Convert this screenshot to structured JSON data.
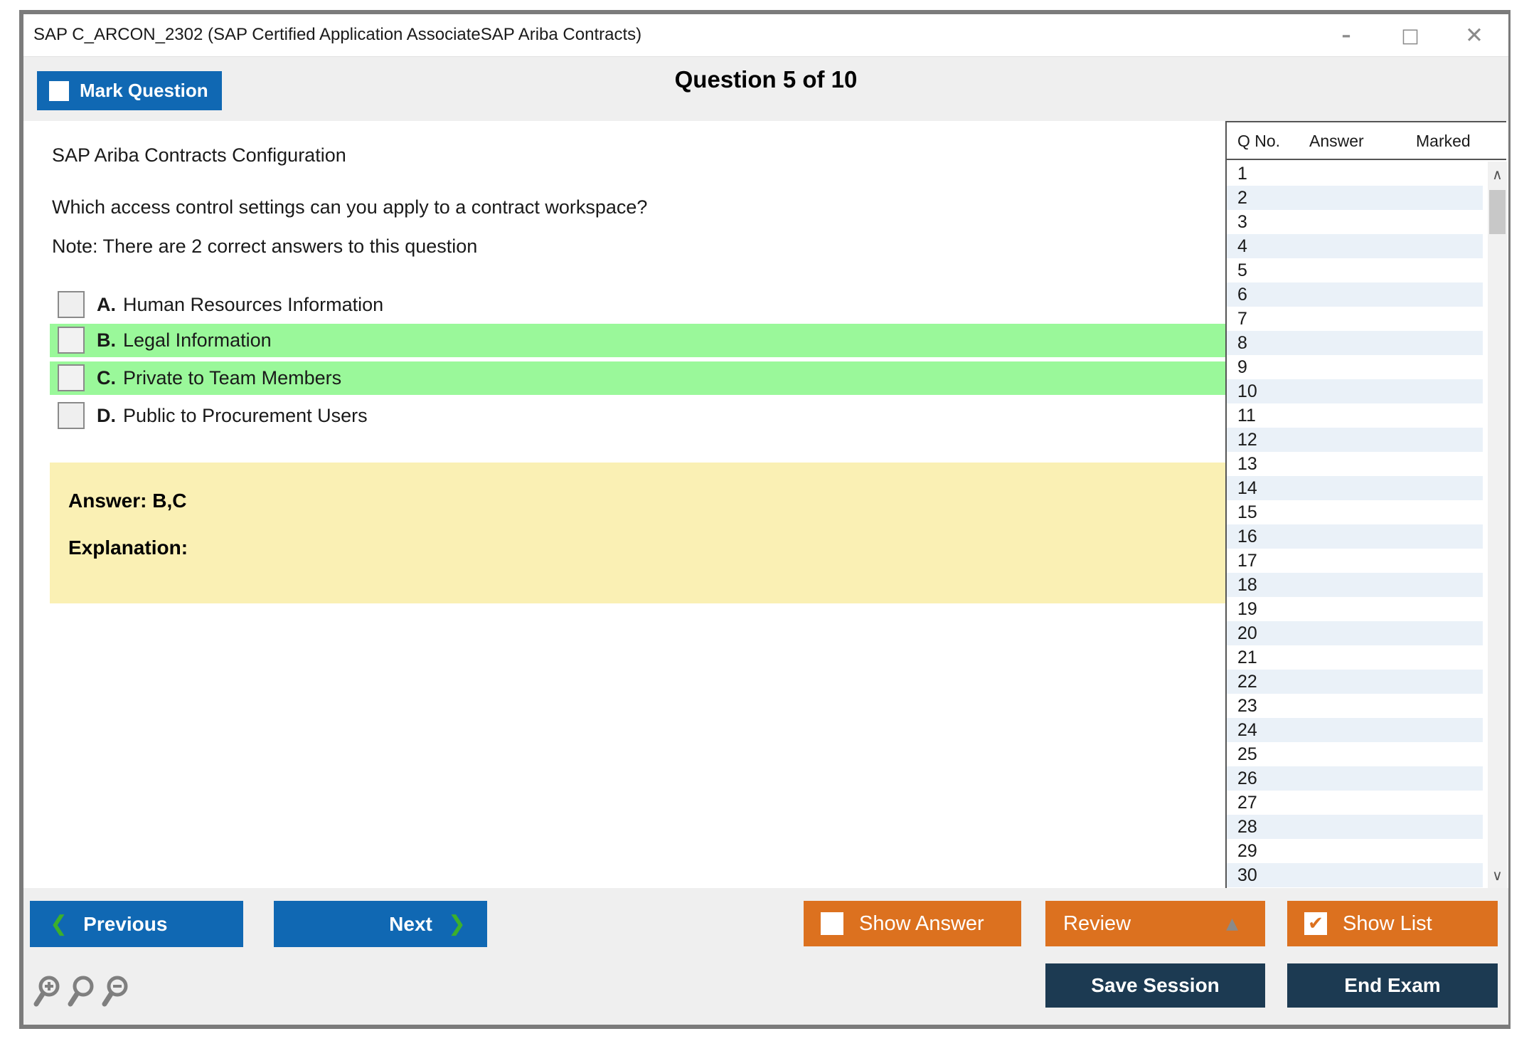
{
  "window": {
    "title": "SAP C_ARCON_2302 (SAP Certified Application AssociateSAP Ariba Contracts)",
    "controls": {
      "minimize_glyph": "–",
      "maximize_glyph": "□",
      "close_glyph": "✕"
    }
  },
  "header": {
    "mark_question_label": "Mark Question",
    "question_counter": "Question 5 of 10"
  },
  "question": {
    "topic": "SAP Ariba Contracts Configuration",
    "text": "Which access control settings can you apply to a contract workspace?",
    "note": "Note: There are 2 correct answers to this question",
    "options": [
      {
        "letter": "A.",
        "label": "Human Resources Information",
        "highlighted": false
      },
      {
        "letter": "B.",
        "label": "Legal Information",
        "highlighted": true
      },
      {
        "letter": "C.",
        "label": "Private to Team Members",
        "highlighted": true
      },
      {
        "letter": "D.",
        "label": "Public to Procurement Users",
        "highlighted": false
      }
    ],
    "answer_label": "Answer: B,C",
    "explanation_label": "Explanation:"
  },
  "question_list": {
    "columns": [
      "Q No.",
      "Answer",
      "Marked"
    ],
    "rows": [
      "1",
      "2",
      "3",
      "4",
      "5",
      "6",
      "7",
      "8",
      "9",
      "10",
      "11",
      "12",
      "13",
      "14",
      "15",
      "16",
      "17",
      "18",
      "19",
      "20",
      "21",
      "22",
      "23",
      "24",
      "25",
      "26",
      "27",
      "28",
      "29",
      "30"
    ],
    "scroll_up_glyph": "∧",
    "scroll_down_glyph": "∨"
  },
  "footer": {
    "previous_label": "Previous",
    "next_label": "Next",
    "prev_chevron": "❮",
    "next_chevron": "❯",
    "show_answer_label": "Show Answer",
    "review_label": "Review",
    "review_arrow_glyph": "▲",
    "show_list_label": "Show List",
    "show_list_check_glyph": "✔",
    "save_session_label": "Save Session",
    "end_exam_label": "End Exam"
  },
  "colors": {
    "accent_blue": "#1068B3",
    "accent_orange": "#DC711F",
    "navy": "#1C3A52",
    "highlight_green": "#9AF89A",
    "answer_yellow": "#FAF0B4",
    "alt_row_blue": "#EAF1F8",
    "band_gray": "#EFEFEF",
    "chevron_green": "#3CB02C"
  }
}
